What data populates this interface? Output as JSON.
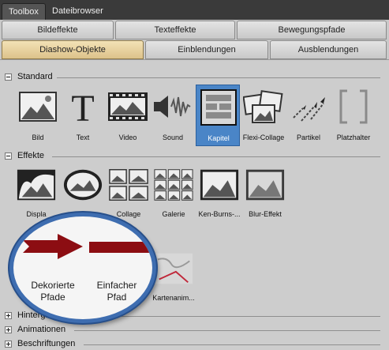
{
  "top_tabs": [
    "Toolbox",
    "Dateibrowser"
  ],
  "tabs_row1": [
    "Bildeffekte",
    "Texteffekte",
    "Bewegungspfade"
  ],
  "tabs_row2": [
    "Diashow-Objekte",
    "Einblendungen",
    "Ausblendungen"
  ],
  "sections": {
    "standard": {
      "title": "Standard",
      "items": [
        "Bild",
        "Text",
        "Video",
        "Sound",
        "Kapitel",
        "Flexi-Collage",
        "Partikel",
        "Platzhalter"
      ],
      "selected": "Kapitel"
    },
    "effekte": {
      "title": "Effekte",
      "items": [
        "Displa",
        "",
        "Collage",
        "Galerie",
        "Ken-Burns-...",
        "Blur-Effekt"
      ]
    },
    "karten": {
      "item_label": "Kartenanim..."
    },
    "collapsed": [
      "Hintergründe",
      "Animationen",
      "Beschriftungen"
    ]
  },
  "magnifier": {
    "left_label": "Dekorierte\nPfade",
    "right_label": "Einfacher\nPfad"
  },
  "colors": {
    "selected_bg": "#4a85c7",
    "active_tab": "#dcc28a",
    "arrow_red": "#8c0d12",
    "magnifier_border": "#3e6db0"
  }
}
